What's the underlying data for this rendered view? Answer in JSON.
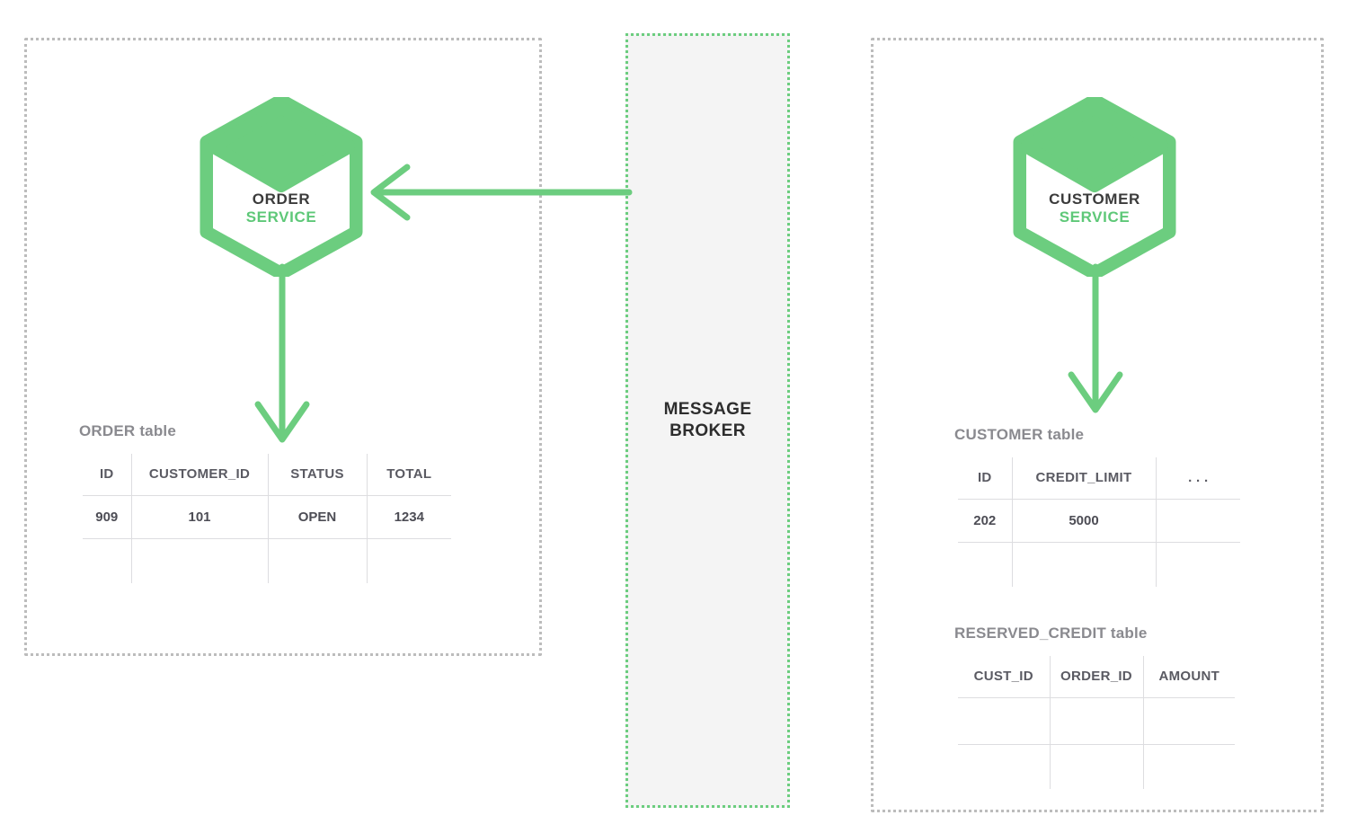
{
  "colors": {
    "accent_green": "#6ccd7f",
    "service_green": "#5ec878",
    "boundary_gray": "#bcbcbc",
    "broker_fill": "#f4f4f4",
    "table_border": "#6e6e73",
    "caption_gray": "#8a8a8f",
    "text_dark": "#3b3b3b",
    "background": "#ffffff"
  },
  "broker": {
    "label": "MESSAGE\nBROKER",
    "label_line1": "MESSAGE",
    "label_line2": "BROKER"
  },
  "services": [
    {
      "id": "order-service",
      "name_line1": "ORDER",
      "name_line2": "SERVICE",
      "icon": "hexagon-cube-icon"
    },
    {
      "id": "customer-service",
      "name_line1": "CUSTOMER",
      "name_line2": "SERVICE",
      "icon": "hexagon-cube-icon"
    }
  ],
  "arrows": [
    {
      "id": "broker-to-order-service",
      "direction": "left",
      "from": "message-broker",
      "to": "order-service"
    },
    {
      "id": "order-service-to-order-table",
      "direction": "down",
      "from": "order-service",
      "to": "order-table"
    },
    {
      "id": "customer-service-to-customer-table",
      "direction": "down",
      "from": "customer-service",
      "to": "customer-table"
    }
  ],
  "tables": [
    {
      "id": "order-table",
      "caption": "ORDER table",
      "columns": [
        "ID",
        "CUSTOMER_ID",
        "STATUS",
        "TOTAL"
      ],
      "rows": [
        [
          "909",
          "101",
          "OPEN",
          "1234"
        ],
        [
          "",
          "",
          "",
          ""
        ]
      ]
    },
    {
      "id": "customer-table",
      "caption": "CUSTOMER table",
      "columns": [
        "ID",
        "CREDIT_LIMIT",
        ". . ."
      ],
      "rows": [
        [
          "202",
          "5000",
          ""
        ],
        [
          "",
          "",
          ""
        ]
      ]
    },
    {
      "id": "reserved-credit-table",
      "caption": "RESERVED_CREDIT table",
      "columns": [
        "CUST_ID",
        "ORDER_ID",
        "AMOUNT"
      ],
      "rows": [
        [
          "",
          "",
          ""
        ],
        [
          "",
          "",
          ""
        ]
      ]
    }
  ]
}
